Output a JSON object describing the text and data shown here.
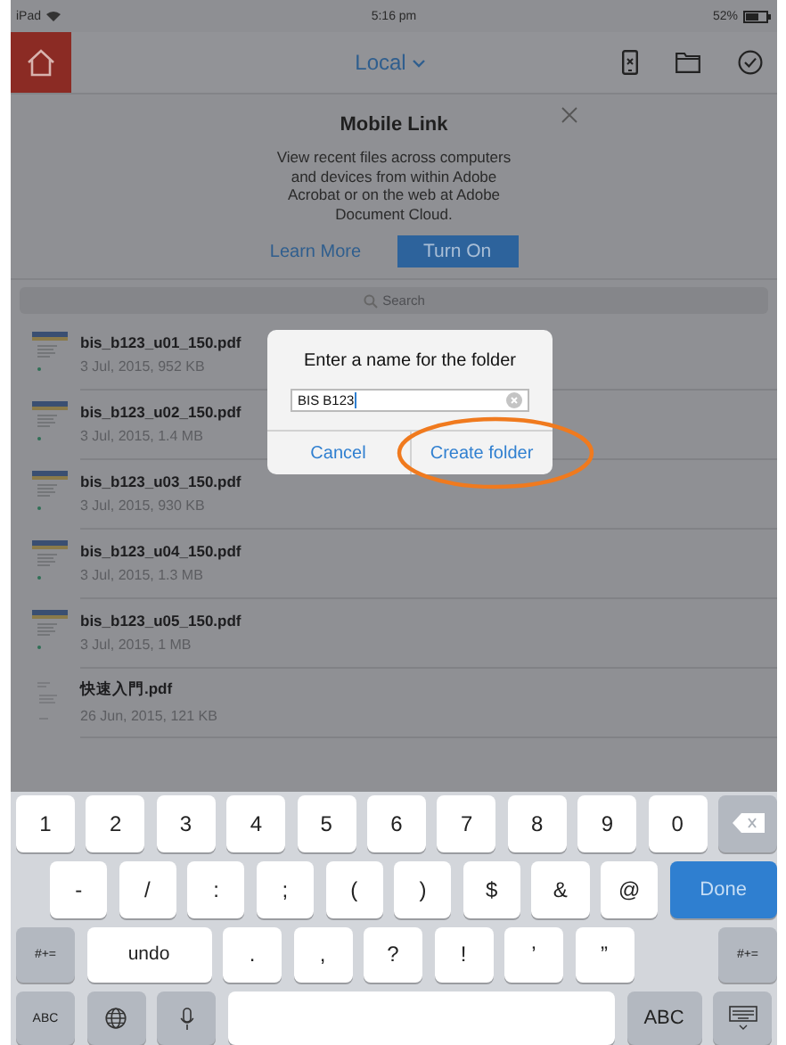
{
  "status_bar": {
    "device": "iPad",
    "time": "5:16 pm",
    "battery": "52%"
  },
  "nav": {
    "title": "Local"
  },
  "banner": {
    "title": "Mobile Link",
    "text": "View recent files across computers and devices from within Adobe Acrobat or on the web at Adobe Document Cloud.",
    "link": "Learn More",
    "button": "Turn On"
  },
  "search": {
    "placeholder": "Search"
  },
  "files": [
    {
      "name": "bis_b123_u01_150.pdf",
      "meta": "3 Jul, 2015, 952 KB",
      "kind": "cover"
    },
    {
      "name": "bis_b123_u02_150.pdf",
      "meta": "3 Jul, 2015, 1.4 MB",
      "kind": "cover"
    },
    {
      "name": "bis_b123_u03_150.pdf",
      "meta": "3 Jul, 2015, 930 KB",
      "kind": "cover"
    },
    {
      "name": "bis_b123_u04_150.pdf",
      "meta": "3 Jul, 2015, 1.3 MB",
      "kind": "cover"
    },
    {
      "name": "bis_b123_u05_150.pdf",
      "meta": "3 Jul, 2015, 1 MB",
      "kind": "cover"
    },
    {
      "name": "快速入門.pdf",
      "meta": "26 Jun, 2015, 121 KB",
      "kind": "plain"
    }
  ],
  "dialog": {
    "title": "Enter a name for the folder",
    "value": "BIS B123",
    "cancel": "Cancel",
    "confirm": "Create folder",
    "highlighted": true
  },
  "keyboard": [
    [
      {
        "kind": "char",
        "label": "1"
      },
      {
        "kind": "char",
        "label": "2"
      },
      {
        "kind": "char",
        "label": "3"
      },
      {
        "kind": "char",
        "label": "4"
      },
      {
        "kind": "char",
        "label": "5"
      },
      {
        "kind": "char",
        "label": "6"
      },
      {
        "kind": "char",
        "label": "7"
      },
      {
        "kind": "char",
        "label": "8"
      },
      {
        "kind": "char",
        "label": "9"
      },
      {
        "kind": "char",
        "label": "0"
      },
      {
        "kind": "delete"
      }
    ],
    [
      {
        "kind": "char",
        "label": "-"
      },
      {
        "kind": "char",
        "label": "/"
      },
      {
        "kind": "char",
        "label": ":"
      },
      {
        "kind": "char",
        "label": ";"
      },
      {
        "kind": "char",
        "label": "("
      },
      {
        "kind": "char",
        "label": ")"
      },
      {
        "kind": "char",
        "label": "$"
      },
      {
        "kind": "char",
        "label": "&"
      },
      {
        "kind": "char",
        "label": "@"
      },
      {
        "kind": "done",
        "label": "Done"
      }
    ],
    [
      {
        "kind": "func",
        "label": "#+="
      },
      {
        "kind": "wide",
        "label": "undo"
      },
      {
        "kind": "char",
        "label": "."
      },
      {
        "kind": "char",
        "label": ","
      },
      {
        "kind": "char",
        "label": "?"
      },
      {
        "kind": "char",
        "label": "!"
      },
      {
        "kind": "char",
        "label": "’"
      },
      {
        "kind": "char",
        "label": "”"
      },
      {
        "kind": "func",
        "label": "#+="
      }
    ],
    [
      {
        "kind": "func",
        "label": "ABC"
      },
      {
        "kind": "globe"
      },
      {
        "kind": "mic"
      },
      {
        "kind": "space"
      },
      {
        "kind": "funcwide",
        "label": "ABC"
      },
      {
        "kind": "hide"
      }
    ]
  ]
}
